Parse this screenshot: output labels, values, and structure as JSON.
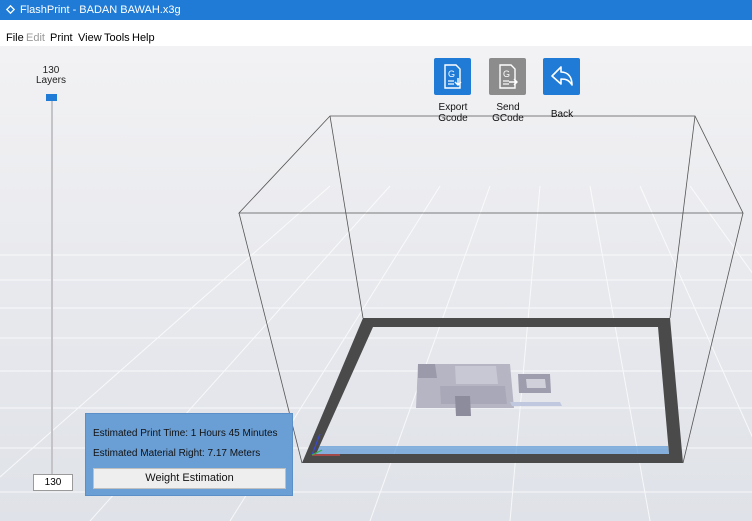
{
  "window": {
    "title": "FlashPrint - BADAN BAWAH.x3g"
  },
  "menu": [
    {
      "label": "File",
      "enabled": true
    },
    {
      "label": "Edit",
      "enabled": false
    },
    {
      "label": "Print",
      "enabled": true
    },
    {
      "label": "View",
      "enabled": true
    },
    {
      "label": "Tools",
      "enabled": true
    },
    {
      "label": "Help",
      "enabled": true
    }
  ],
  "layers": {
    "count": "130",
    "label": "Layers",
    "current": "130"
  },
  "toolbar": {
    "export_label": "Export\nGcode",
    "send_label": "Send\nGCode",
    "back_label": "Back"
  },
  "estimate": {
    "print_time": "Estimated Print Time:  1 Hours 45 Minutes",
    "material": "Estimated Material Right:  7.17 Meters",
    "weight_button": "Weight Estimation"
  },
  "colors": {
    "accent": "#1f7bd6",
    "panel": "#6a9fd6",
    "platform_border": "#4a4a4a",
    "model": "#bdbdc9"
  }
}
